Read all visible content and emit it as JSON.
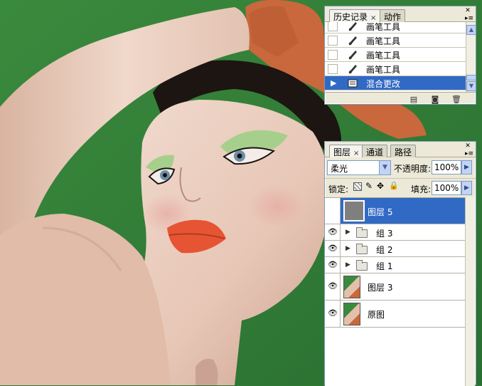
{
  "history_panel": {
    "tabs": [
      {
        "label": "历史记录"
      },
      {
        "label": "动作"
      }
    ],
    "close_glyph": "×",
    "items": [
      {
        "label": "画笔工具",
        "icon": "brush-icon"
      },
      {
        "label": "画笔工具",
        "icon": "brush-icon"
      },
      {
        "label": "画笔工具",
        "icon": "brush-icon"
      },
      {
        "label": "画笔工具",
        "icon": "brush-icon"
      },
      {
        "label": "混合更改",
        "icon": "blend-change-icon",
        "selected": true
      }
    ]
  },
  "layers_panel": {
    "tabs": [
      {
        "label": "图层"
      },
      {
        "label": "通道"
      },
      {
        "label": "路径"
      }
    ],
    "close_glyph": "×",
    "blend_mode": "柔光",
    "opacity_label": "不透明度:",
    "opacity_value": "100%",
    "lock_label": "锁定:",
    "fill_label": "填充:",
    "fill_value": "100%",
    "layers": [
      {
        "name": "图层 5",
        "type": "layer",
        "selected": true
      },
      {
        "name": "组 3",
        "type": "group"
      },
      {
        "name": "组 2",
        "type": "group"
      },
      {
        "name": "组 1",
        "type": "group"
      },
      {
        "name": "图层 3",
        "type": "layer"
      },
      {
        "name": "原图",
        "type": "layer"
      }
    ]
  },
  "colors": {
    "selection": "#316ac5",
    "background_green": "#2f7a35",
    "panel_bg": "#ece9d8"
  }
}
